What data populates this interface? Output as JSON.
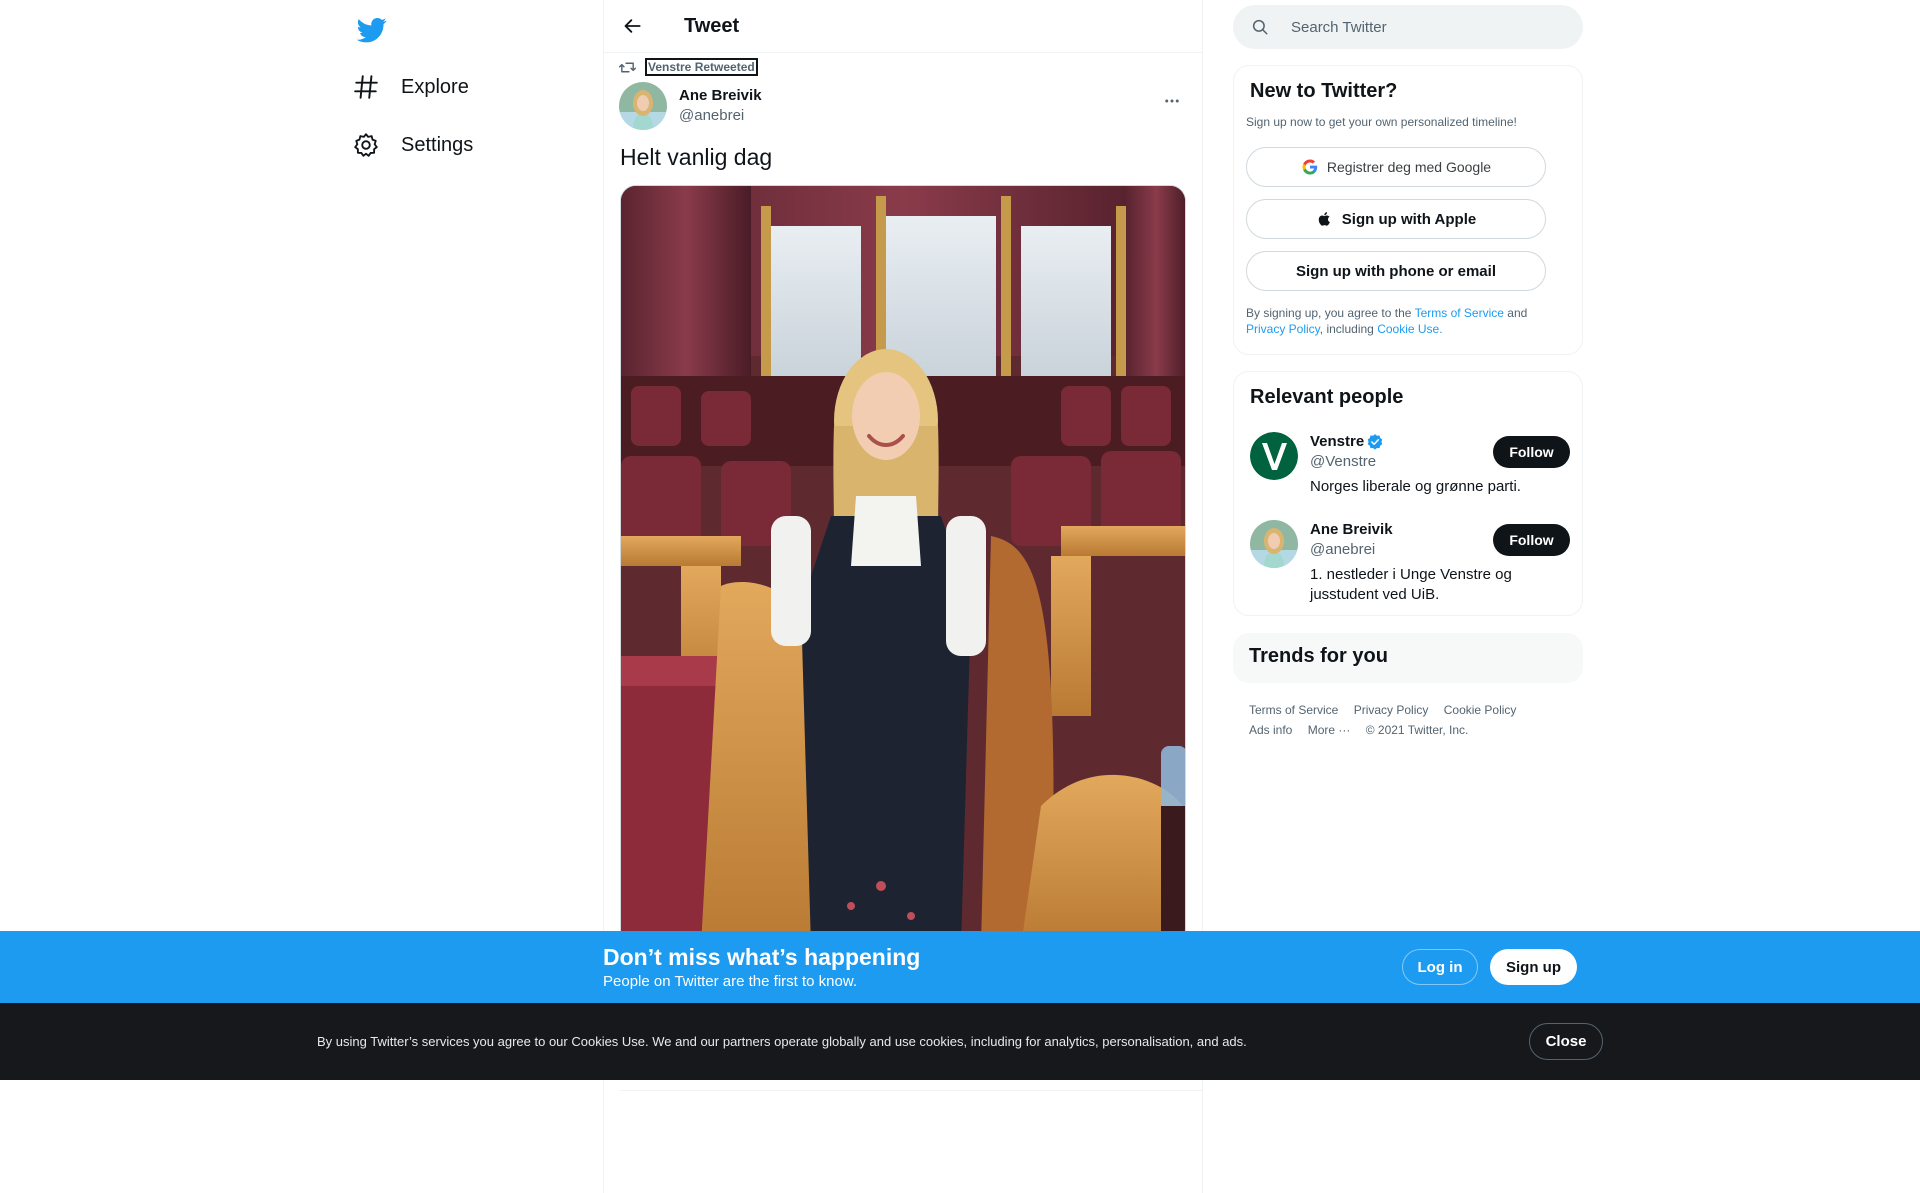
{
  "nav": {
    "items": [
      {
        "label": "Explore",
        "icon": "hashtag-icon"
      },
      {
        "label": "Settings",
        "icon": "gear-icon"
      }
    ]
  },
  "main": {
    "title": "Tweet",
    "retweet_label": "Venstre Retweeted",
    "author": {
      "name": "Ane Breivik",
      "handle": "@anebrei"
    },
    "tweet_text": "Helt vanlig dag"
  },
  "sidebar": {
    "search_placeholder": "Search Twitter",
    "new_to_twitter": {
      "title": "New to Twitter?",
      "subtitle": "Sign up now to get your own personalized timeline!",
      "google_button": "Registrer deg med Google",
      "apple_button": "Sign up with Apple",
      "phone_button": "Sign up with phone or email",
      "legal_prefix": "By signing up, you agree to the",
      "terms_link": "Terms of Service",
      "legal_and": "and",
      "privacy_link": "Privacy Policy",
      "legal_including": ", including",
      "cookie_link": "Cookie Use."
    },
    "relevant_people": {
      "title": "Relevant people",
      "people": [
        {
          "name": "Venstre",
          "handle": "@Venstre",
          "bio": "Norges liberale og grønne parti.",
          "follow": "Follow",
          "verified": true
        },
        {
          "name": "Ane Breivik",
          "handle": "@anebrei",
          "bio": "1. nestleder i Unge Venstre og jusstudent ved UiB.",
          "follow": "Follow",
          "verified": false
        }
      ]
    },
    "trends": {
      "title": "Trends for you"
    },
    "footer": {
      "links": [
        "Terms of Service",
        "Privacy Policy",
        "Cookie Policy",
        "Ads info",
        "More ···"
      ],
      "copyright": "© 2021 Twitter, Inc."
    }
  },
  "banner": {
    "title": "Don’t miss what’s happening",
    "subtitle": "People on Twitter are the first to know.",
    "login": "Log in",
    "signup": "Sign up"
  },
  "cookie": {
    "text": "By using Twitter’s services you agree to our Cookies Use. We and our partners operate globally and use cookies, including for analytics, personalisation, and ads.",
    "close": "Close"
  },
  "colors": {
    "brand": "#1d9bf0",
    "text": "#0f1419",
    "muted": "#536471",
    "cookie_bg": "#16181c"
  }
}
